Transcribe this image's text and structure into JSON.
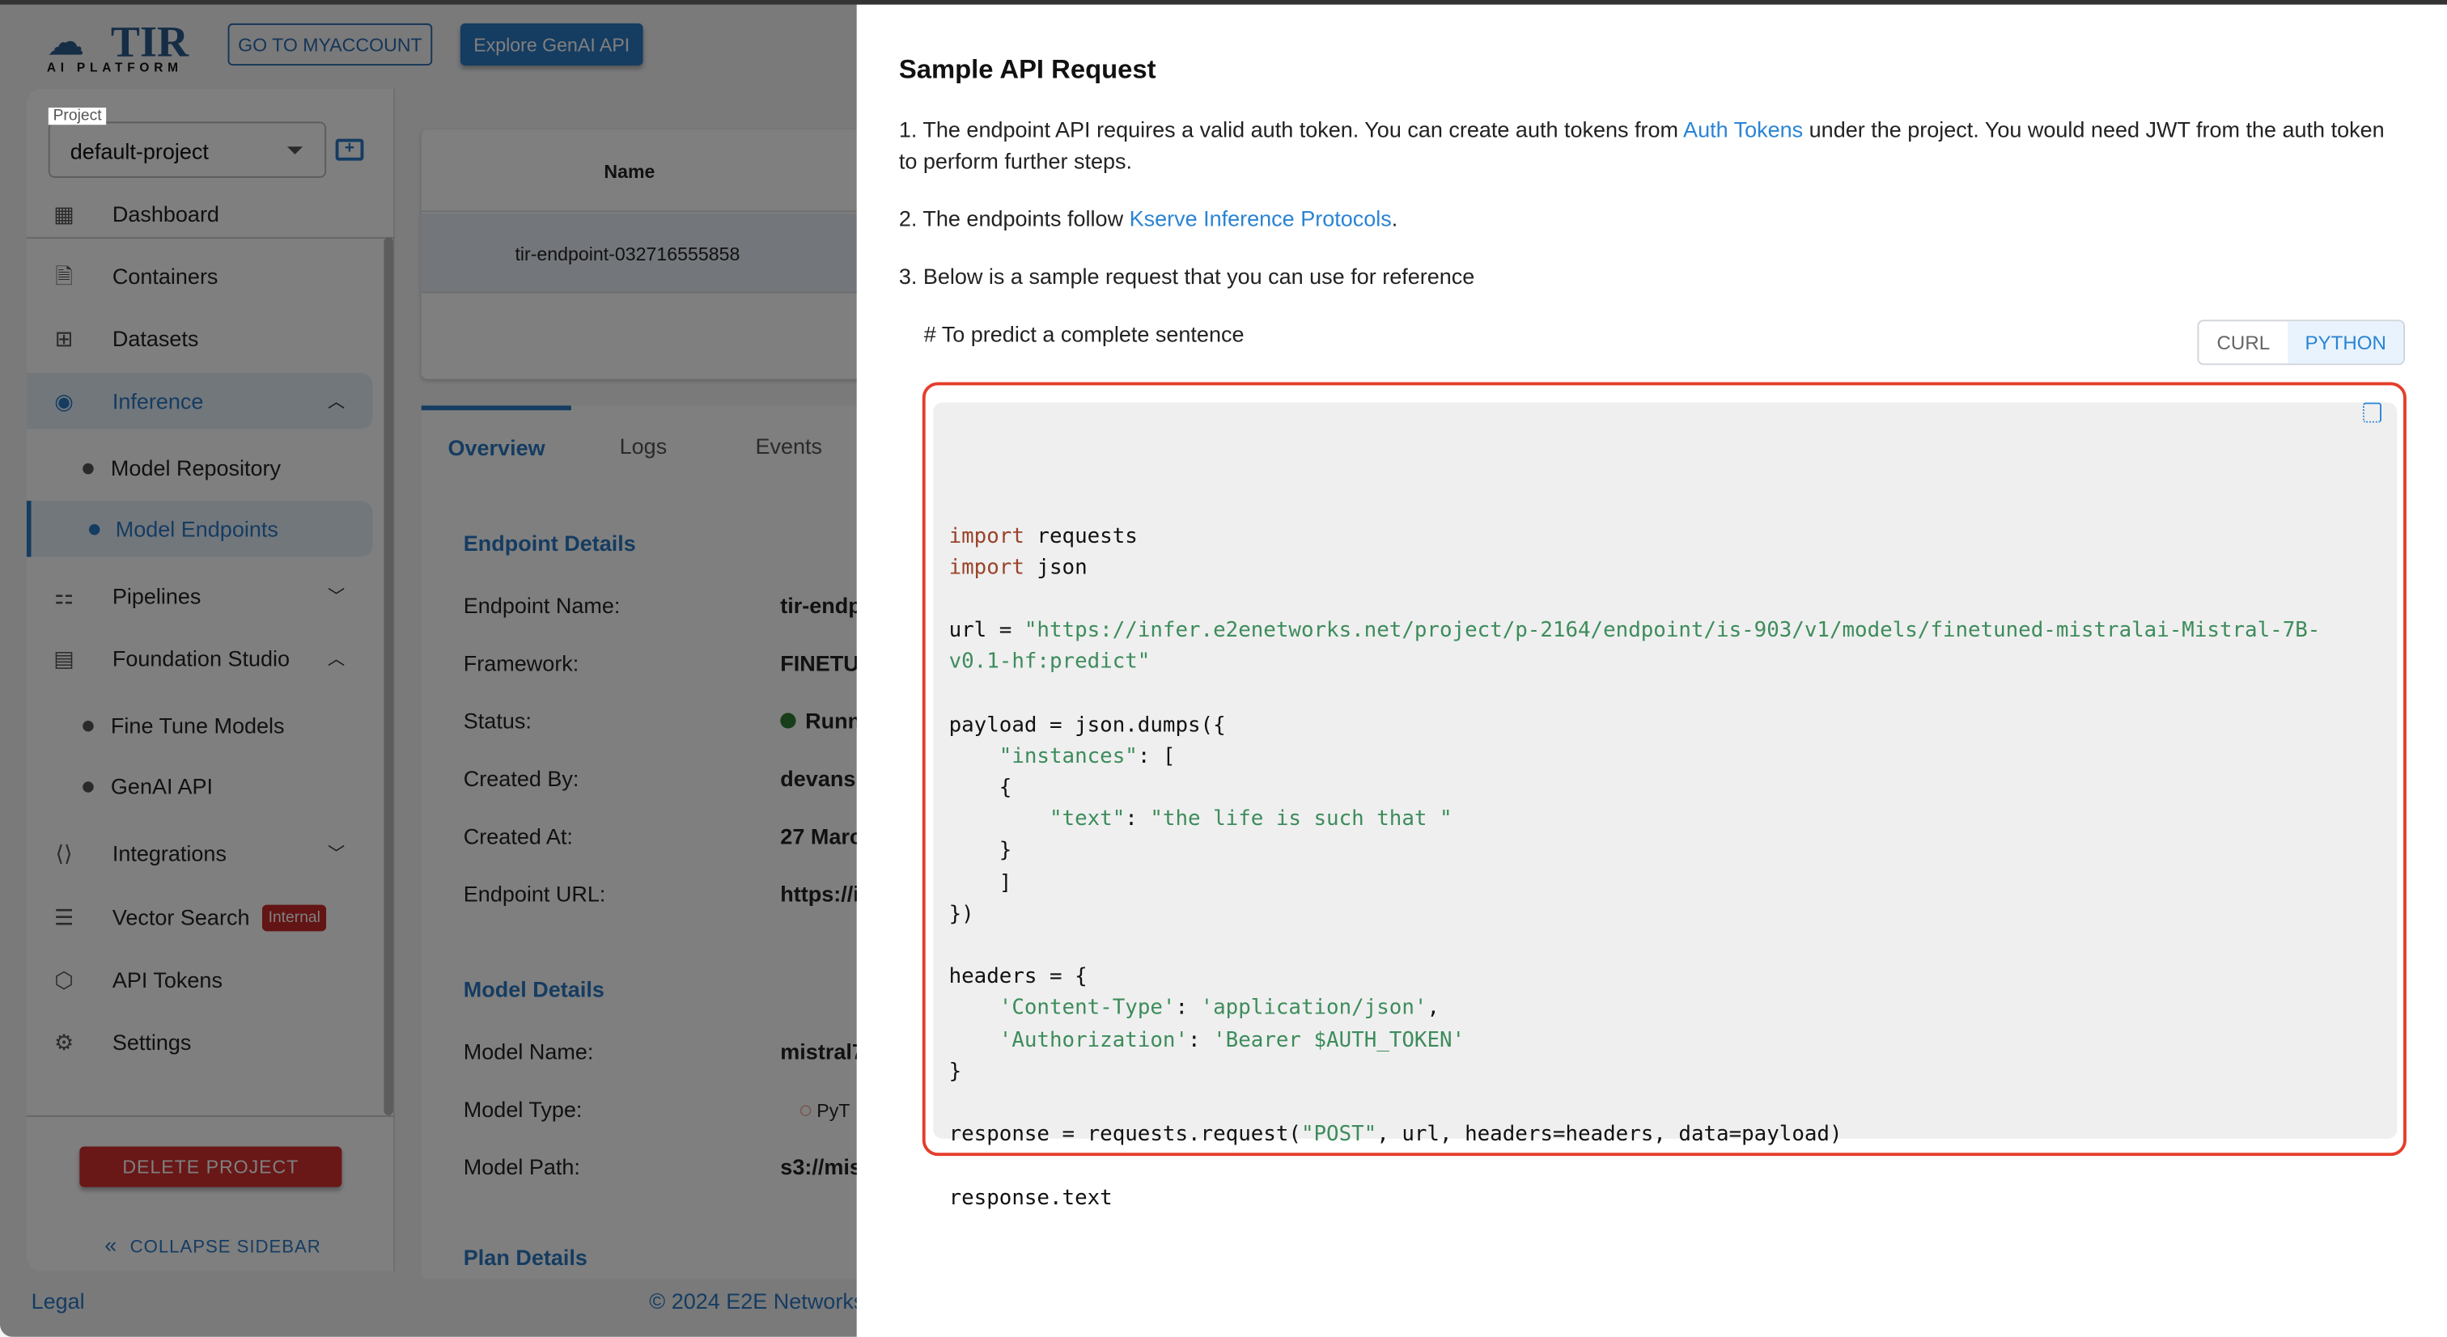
{
  "header": {
    "logo_text": "TIR",
    "logo_sub": "AI PLATFORM",
    "myaccount_label": "GO TO MYACCOUNT",
    "genai_label": "Explore GenAI API"
  },
  "sidebar": {
    "project_label": "Project",
    "project_value": "default-project",
    "items": [
      {
        "label": "Dashboard",
        "icon": "dashboard-icon"
      },
      {
        "label": "Containers",
        "icon": "file-icon"
      },
      {
        "label": "Datasets",
        "icon": "dataset-icon"
      },
      {
        "label": "Inference",
        "icon": "inference-icon",
        "expanded": true,
        "active": true
      },
      {
        "label": "Model Repository"
      },
      {
        "label": "Model Endpoints",
        "active": true
      },
      {
        "label": "Pipelines",
        "icon": "pipeline-icon",
        "expanded": false
      },
      {
        "label": "Foundation Studio",
        "icon": "studio-icon",
        "expanded": true
      },
      {
        "label": "Fine Tune Models"
      },
      {
        "label": "GenAI API"
      },
      {
        "label": "Integrations",
        "icon": "integrations-icon",
        "expanded": false
      },
      {
        "label": "Vector Search",
        "icon": "vector-icon",
        "badge": "Internal"
      },
      {
        "label": "API Tokens",
        "icon": "token-icon"
      },
      {
        "label": "Settings",
        "icon": "gear-icon"
      }
    ],
    "delete_label": "DELETE PROJECT",
    "collapse_label": "COLLAPSE SIDEBAR"
  },
  "main": {
    "table_header": "Name",
    "table_row": "tir-endpoint-032716555858",
    "tabs": [
      "Overview",
      "Logs",
      "Events"
    ],
    "endpoint_section": "Endpoint Details",
    "endpoint_fields": [
      {
        "k": "Endpoint Name:",
        "v": "tir-endp"
      },
      {
        "k": "Framework:",
        "v": "FINETU"
      },
      {
        "k": "Status:",
        "v": "Runn"
      },
      {
        "k": "Created By:",
        "v": "devansh"
      },
      {
        "k": "Created At:",
        "v": "27 Marc"
      },
      {
        "k": "Endpoint URL:",
        "v": "https://i"
      }
    ],
    "model_section": "Model Details",
    "model_fields": [
      {
        "k": "Model Name:",
        "v": "mistral7"
      },
      {
        "k": "Model Type:",
        "v": "PyT"
      },
      {
        "k": "Model Path:",
        "v": "s3://mis"
      }
    ],
    "plan_section": "Plan Details",
    "status_color": "#2e7d32"
  },
  "footer": {
    "legal": "Legal",
    "copyright": "© 2024 E2E Networks"
  },
  "drawer": {
    "title": "Sample API Request",
    "p1_a": "1. The endpoint API requires a valid auth token. You can create auth tokens from ",
    "p1_link": "Auth Tokens",
    "p1_b": " under the project. You would need JWT from the auth token to perform further steps.",
    "p2_a": "2. The endpoints follow ",
    "p2_link": "Kserve Inference Protocols",
    "p2_b": ".",
    "p3": "3. Below is a sample request that you can use for reference",
    "hint": "# To predict a complete sentence",
    "toggle": {
      "curl": "CURL",
      "python": "PYTHON",
      "selected": "PYTHON"
    },
    "code": [
      [
        {
          "k": "kw",
          "t": "import"
        },
        {
          "t": " requests"
        }
      ],
      [
        {
          "k": "kw",
          "t": "import"
        },
        {
          "t": " json"
        }
      ],
      [],
      [
        {
          "t": "url = "
        },
        {
          "k": "str",
          "t": "\"https://infer.e2enetworks.net/project/p-2164/endpoint/is-903/v1/models/finetuned-mistralai-Mistral-7B-"
        }
      ],
      [
        {
          "k": "str",
          "t": "v0.1-hf:predict\""
        }
      ],
      [],
      [
        {
          "t": "payload = json.dumps({"
        }
      ],
      [
        {
          "t": "    "
        },
        {
          "k": "str",
          "t": "\"instances\""
        },
        {
          "t": ": ["
        }
      ],
      [
        {
          "t": "    {"
        }
      ],
      [
        {
          "t": "        "
        },
        {
          "k": "str",
          "t": "\"text\""
        },
        {
          "t": ": "
        },
        {
          "k": "str",
          "t": "\"the life is such that \""
        }
      ],
      [
        {
          "t": "    }"
        }
      ],
      [
        {
          "t": "    ]"
        }
      ],
      [
        {
          "t": "})"
        }
      ],
      [],
      [
        {
          "t": "headers = {"
        }
      ],
      [
        {
          "t": "    "
        },
        {
          "k": "str",
          "t": "'Content-Type'"
        },
        {
          "t": ": "
        },
        {
          "k": "str",
          "t": "'application/json'"
        },
        {
          "t": ","
        }
      ],
      [
        {
          "t": "    "
        },
        {
          "k": "str",
          "t": "'Authorization'"
        },
        {
          "t": ": "
        },
        {
          "k": "str",
          "t": "'Bearer $AUTH_TOKEN'"
        }
      ],
      [
        {
          "t": "}"
        }
      ],
      [],
      [
        {
          "t": "response = requests.request("
        },
        {
          "k": "str",
          "t": "\"POST\""
        },
        {
          "t": ", url, headers=headers, data=payload)"
        }
      ],
      [],
      [
        {
          "t": "response.text"
        }
      ]
    ],
    "highlight_color": "#e53e2a"
  }
}
